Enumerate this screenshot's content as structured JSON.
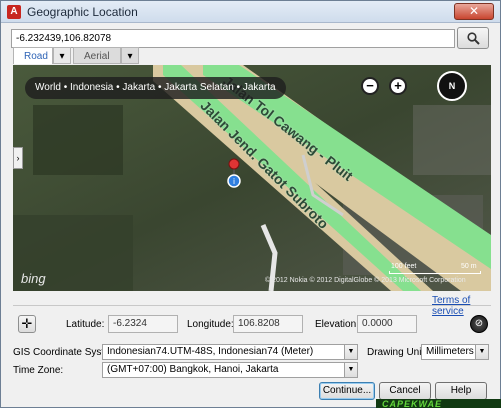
{
  "window": {
    "title": "Geographic Location",
    "close_label": "✕"
  },
  "search": {
    "value": "-6.232439,106.82078"
  },
  "tabs": [
    {
      "label": "Road",
      "active": true
    },
    {
      "label": "Aerial",
      "active": false
    }
  ],
  "map": {
    "breadcrumb": "World • Indonesia • Jakarta • Jakarta Selatan • Jakarta",
    "zoom_out": "−",
    "zoom_in": "+",
    "compass_label": "N",
    "road_labels": [
      "Jalan Tol Cawang - Pluit",
      "Jalan Jend. Gatot Subroto"
    ],
    "bing_logo": "bing",
    "scale_feet": "100 feet",
    "scale_meters": "50 m",
    "copyright": "© 2012 Nokia  © 2012 DigitalGlobe  © 2013 Microsoft Corporation"
  },
  "terms_link": "Terms of service",
  "coordinates": {
    "latitude_label": "Latitude:",
    "latitude_value": "-6.2324",
    "longitude_label": "Longitude:",
    "longitude_value": "106.8208",
    "elevation_label": "Elevation:",
    "elevation_value": "0.0000"
  },
  "gis": {
    "label": "GIS Coordinate System:",
    "value": "Indonesian74.UTM-48S, Indonesian74 (Meter)"
  },
  "drawing_unit": {
    "label": "Drawing Unit:",
    "value": "Millimeters"
  },
  "time_zone": {
    "label": "Time Zone:",
    "value": "(GMT+07:00) Bangkok, Hanoi, Jakarta"
  },
  "buttons": {
    "continue": "Continue...",
    "cancel": "Cancel",
    "help": "Help"
  },
  "watermark": "CAPEKWAE",
  "colors": {
    "accent": "#2f64b6",
    "road_green": "#86e08f",
    "map_dark": "#3b4730"
  }
}
